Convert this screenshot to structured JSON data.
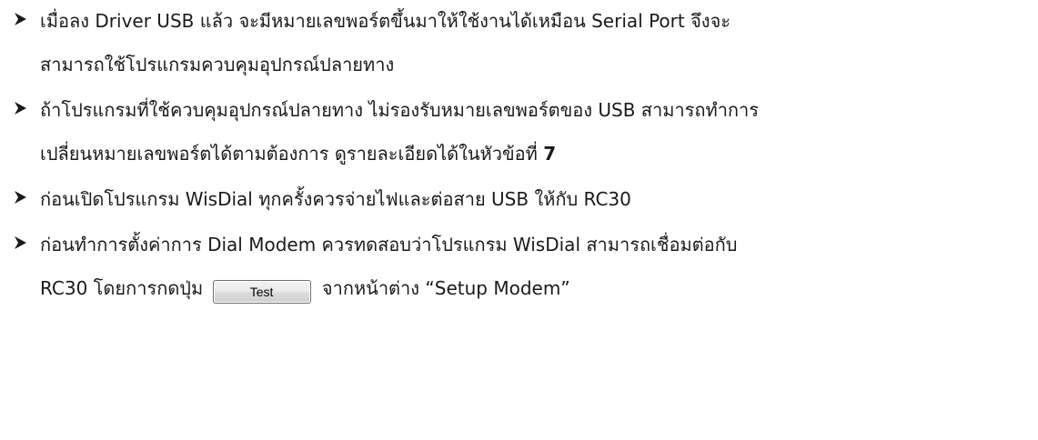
{
  "items": [
    {
      "lines": [
        "เมื่อลง Driver USB แล้ว จะมีหมายเลขพอร์ตขึ้นมาให้ใช้งานได้เหมือน Serial Port จึงจะ",
        "สามารถใช้โปรแกรมควบคุมอุปกรณ์ปลายทาง"
      ]
    },
    {
      "line1": "ถ้าโปรแกรมที่ใช้ควบคุมอุปกรณ์ปลายทาง ไม่รองรับหมายเลขพอร์ตของ USB สามารถทำการ",
      "line2": "เปลี่ยนหมายเลขพอร์ตได้ตามต้องการ ดูรายละเอียดได้ในหัวข้อที่",
      "line2_bold": "7"
    },
    {
      "lines": [
        "ก่อนเปิดโปรแกรม WisDial ทุกครั้งควรจ่ายไฟและต่อสาย USB ให้กับ RC30"
      ]
    },
    {
      "line1": "ก่อนทำการตั้งค่าการ Dial Modem ควรทดสอบว่าโปรแกรม WisDial สามารถเชื่อมต่อกับ",
      "line2_before": "RC30 โดยการกดปุ่ม",
      "button_label": "Test",
      "line2_after": "จากหน้าต่าง “Setup Modem”"
    }
  ],
  "bullet_icon": "arrowhead-bullet-icon"
}
